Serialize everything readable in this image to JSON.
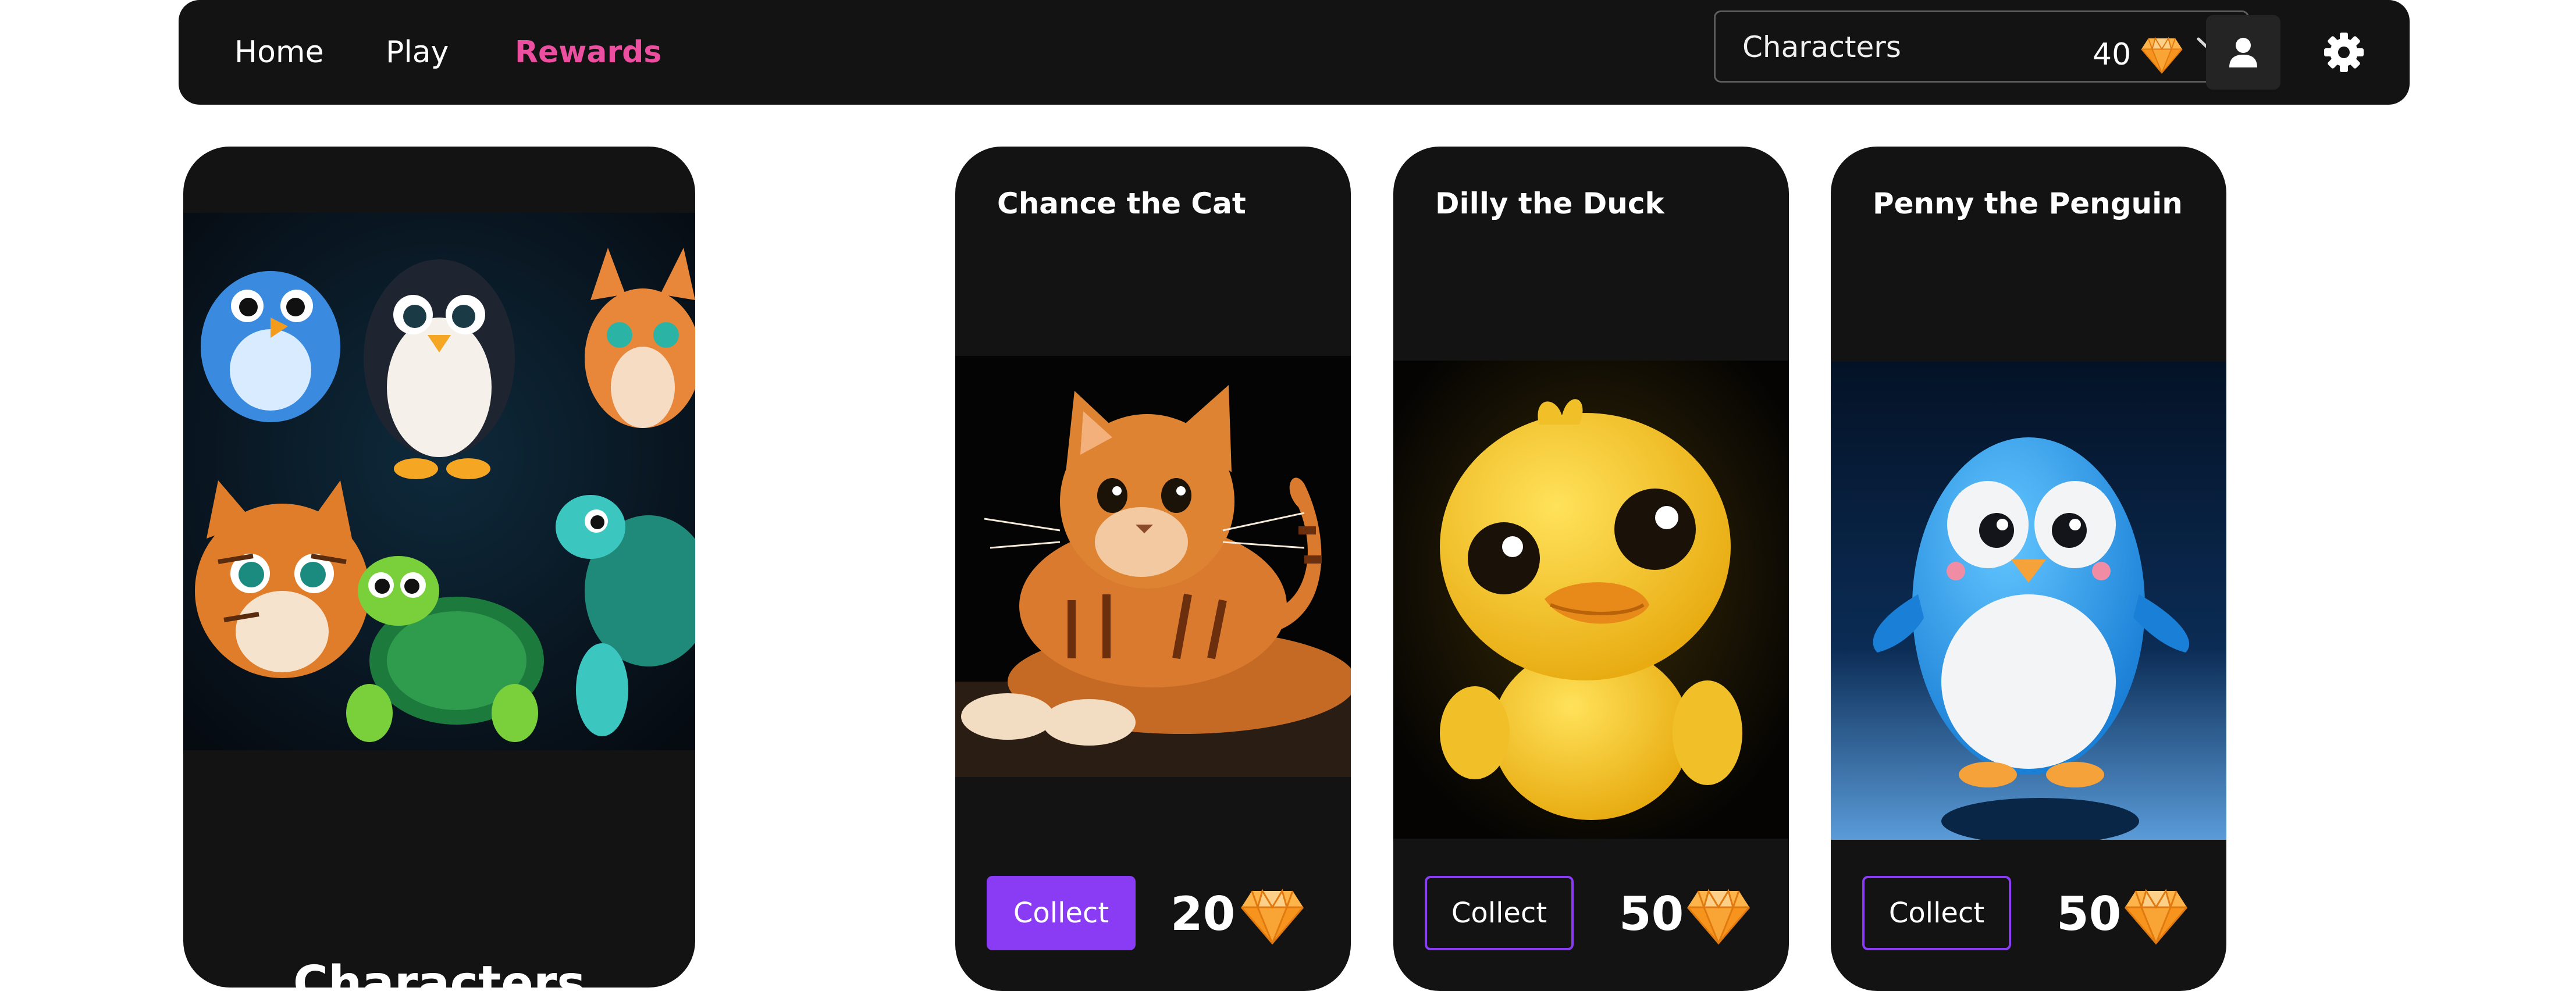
{
  "nav": {
    "links": [
      {
        "label": "Home",
        "active": false
      },
      {
        "label": "Play",
        "active": false
      },
      {
        "label": "Rewards",
        "active": true
      }
    ],
    "category_select": {
      "value": "Characters"
    },
    "gem_balance": "40",
    "active_color": "#ec4fa0"
  },
  "hero_card": {
    "title": "Characters",
    "image": "characters-collage-image"
  },
  "rewards": [
    {
      "name": "Chance the Cat",
      "action": "Collect",
      "price": "20",
      "style": "filled",
      "image": "cat-image"
    },
    {
      "name": "Dilly the Duck",
      "action": "Collect",
      "price": "50",
      "style": "outline",
      "image": "duck-image"
    },
    {
      "name": "Penny the Penguin",
      "action": "Collect",
      "price": "50",
      "style": "outline",
      "image": "penguin-image"
    }
  ],
  "colors": {
    "panel": "#131313",
    "accent": "#8a3cf5",
    "gem": "#f7941d"
  }
}
